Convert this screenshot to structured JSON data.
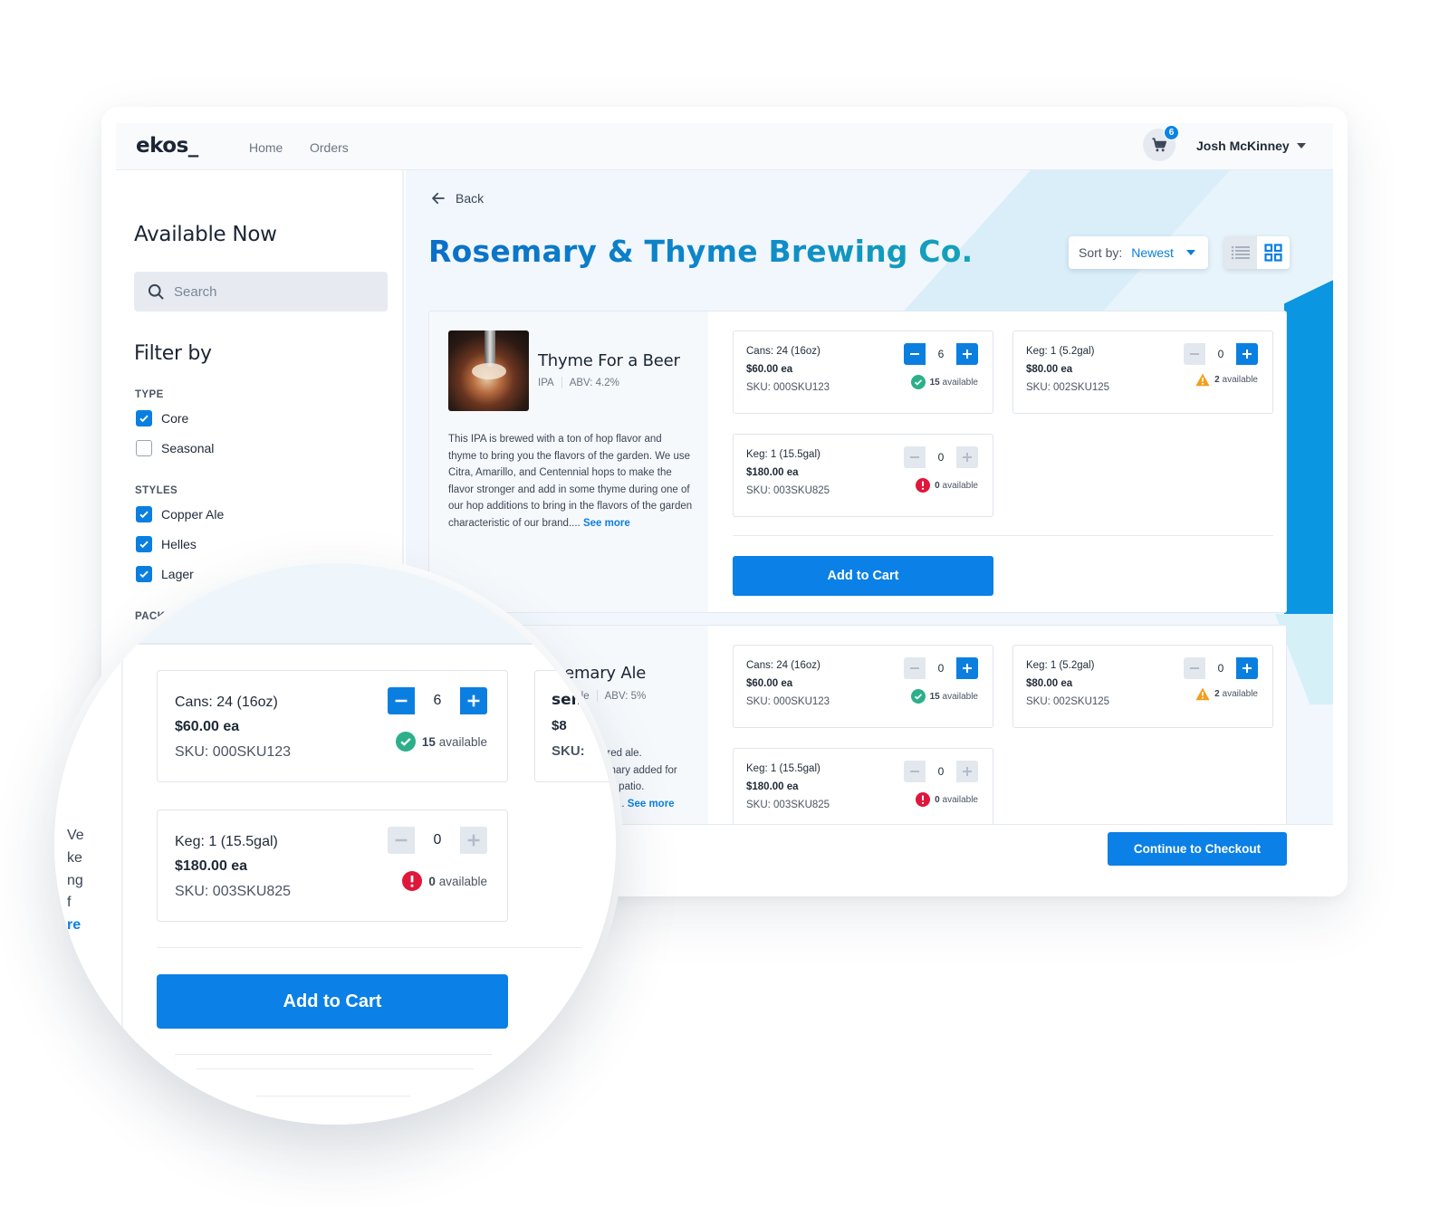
{
  "app": {
    "logo": "ekos_",
    "nav": [
      {
        "label": "Home"
      },
      {
        "label": "Orders"
      }
    ],
    "cart_count": "6",
    "user_name": "Josh McKinney"
  },
  "sidebar": {
    "title": "Available Now",
    "search_placeholder": "Search",
    "filter_title": "Filter by",
    "groups": [
      {
        "label": "TYPE",
        "options": [
          {
            "label": "Core",
            "checked": true
          },
          {
            "label": "Seasonal",
            "checked": false
          }
        ]
      },
      {
        "label": "STYLES",
        "options": [
          {
            "label": "Copper Ale",
            "checked": true
          },
          {
            "label": "Helles",
            "checked": true
          },
          {
            "label": "Lager",
            "checked": true
          }
        ]
      },
      {
        "label": "PACKA",
        "options": []
      }
    ]
  },
  "main": {
    "back_label": "Back",
    "brewery_title": "Rosemary & Thyme Brewing Co.",
    "sort_label": "Sort by:",
    "sort_value": "Newest",
    "view_mode": "grid",
    "colors": {
      "primary": "#0b80e6",
      "title_gradient_start": "#0b6fc7",
      "title_gradient_end": "#15a3b8",
      "available_ok": "#2bb08a",
      "available_low": "#f59e1b",
      "available_none": "#e0163b"
    },
    "products": [
      {
        "name": "Thyme For a Beer",
        "style": "IPA",
        "abv": "ABV: 4.2%",
        "description": "This IPA is brewed with a ton of hop flavor and thyme to bring you the flavors of the garden. We use Citra, Amarillo, and Centennial hops to make the flavor stronger and add in some thyme during one of our hop additions to bring in the flavors of the garden characteristic of our brand....",
        "see_more": "See more",
        "variants": [
          {
            "name": "Cans: 24 (16oz)",
            "price": "$60.00 ea",
            "sku": "SKU: 000SKU123",
            "qty": "6",
            "available_count": "15",
            "available_text": "available",
            "status": "ok",
            "minus_enabled": true,
            "plus_enabled": true
          },
          {
            "name": "Keg: 1 (5.2gal)",
            "price": "$80.00 ea",
            "sku": "SKU: 002SKU125",
            "qty": "0",
            "available_count": "2",
            "available_text": "available",
            "status": "low",
            "minus_enabled": false,
            "plus_enabled": true
          },
          {
            "name": "Keg: 1 (15.5gal)",
            "price": "$180.00 ea",
            "sku": "SKU: 003SKU825",
            "qty": "0",
            "available_count": "0",
            "available_text": "available",
            "status": "none",
            "minus_enabled": false,
            "plus_enabled": false
          }
        ],
        "add_to_cart": "Add to Cart"
      },
      {
        "name_fragment": "semary Ale",
        "style_fragment": "Ale",
        "abv": "ABV: 5%",
        "description_fragments": [
          "ored ale.",
          "emary added for",
          "the patio.",
          "nd...."
        ],
        "see_more": "See more",
        "variants": [
          {
            "name": "Cans: 24 (16oz)",
            "price": "$60.00 ea",
            "sku": "SKU: 000SKU123",
            "qty": "0",
            "available_count": "15",
            "available_text": "available",
            "status": "ok",
            "minus_enabled": false,
            "plus_enabled": true
          },
          {
            "name": "Keg: 1 (5.2gal)",
            "price": "$80.00 ea",
            "sku": "SKU: 002SKU125",
            "qty": "0",
            "available_count": "2",
            "available_text": "available",
            "status": "low",
            "minus_enabled": false,
            "plus_enabled": true
          },
          {
            "name": "Keg: 1 (15.5gal)",
            "price": "$180.00 ea",
            "sku": "SKU: 003SKU825",
            "qty": "0",
            "available_count": "0",
            "available_text": "available",
            "status": "none",
            "minus_enabled": false,
            "plus_enabled": false
          }
        ]
      }
    ],
    "checkout_label": "Continue to Checkout"
  },
  "magnifier": {
    "left_fragments": [
      "Ve",
      "ke",
      "ng",
      "f",
      "re"
    ],
    "behind_fragments": {
      "name": "semary",
      "price": "$8",
      "sku": "SKU:",
      "meta": "Ale",
      "k": "k"
    },
    "variants": [
      {
        "name": "Cans: 24 (16oz)",
        "price": "$60.00 ea",
        "sku": "SKU: 000SKU123",
        "qty": "6",
        "available_count": "15",
        "available_text": "available",
        "status": "ok"
      },
      {
        "name": "Keg: 1 (15.5gal)",
        "price": "$180.00 ea",
        "sku": "SKU: 003SKU825",
        "qty": "0",
        "available_count": "0",
        "available_text": "available",
        "status": "none"
      }
    ],
    "add_to_cart": "Add to Cart"
  }
}
